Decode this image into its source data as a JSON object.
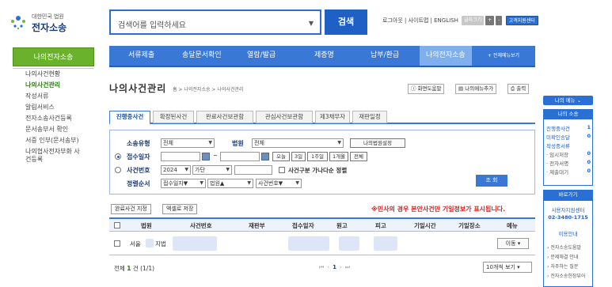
{
  "header": {
    "logo_small": "대한민국 법원",
    "logo_big": "전자소송",
    "search_placeholder": "검색어를 입력하세요",
    "search_button": "검색",
    "toplinks": "로그아웃 | 사이트맵 | ENGLISH",
    "font_label": "글자크기",
    "font_plus": "+",
    "font_minus": "-",
    "support_center": "고객지원센터"
  },
  "left": {
    "title": "나의전자소송",
    "items": [
      {
        "label": "나의사건현황",
        "active": false
      },
      {
        "label": "나의사건관리",
        "active": true
      },
      {
        "label": "작성서류",
        "active": false
      },
      {
        "label": "알림서비스",
        "active": false
      },
      {
        "label": "전자소송사건등록",
        "active": false
      },
      {
        "label": "문서송부서 확인",
        "active": false
      },
      {
        "label": "서증 인부(문서송부)",
        "active": false
      },
      {
        "label": "나의협사전자부화 사건등록",
        "active": false
      }
    ]
  },
  "nav": {
    "items": [
      "서류제출",
      "송달문서확인",
      "열람/발급",
      "제증명",
      "납부/환급",
      "나의전자소송"
    ],
    "more": "+ 전체메뉴보기"
  },
  "page": {
    "title": "나의사건관리",
    "breadcrumb": "홈 > 나의전자소송 > 나의사건관리",
    "help": "화면도움말",
    "add_menu": "나의메뉴추가",
    "print": "출력"
  },
  "tabs": [
    "진행중사건",
    "확정된사건",
    "완료사건보관함",
    "관심사건보관함",
    "제3채무자",
    "재판일정"
  ],
  "filter": {
    "case_type_label": "소송유형",
    "case_type_value": "전체",
    "court_label": "법원",
    "court_value": "전체",
    "my_court_button": "나의법원설정",
    "date_label": "접수일자",
    "date_sep": "~",
    "btn_today": "오늘",
    "btn_3days": "3일",
    "btn_1week": "1주일",
    "btn_1month": "1개월",
    "btn_all": "전체",
    "caseno_label": "사건번호",
    "year_value": "2024",
    "gubun_value": "가단",
    "sort_check_label": "사건구분 가나다순 정렬",
    "order_label": "정렬순서",
    "order1": "접수일자▼",
    "order2": "법원▲",
    "order3": "사건번호▼",
    "lookup": "조 회"
  },
  "results": {
    "btn_complete": "완료사건 지정",
    "btn_excel": "엑셀로 저장",
    "notice": "※민사의 경우 본안사건만 기일정보가 표시됩니다.",
    "columns": [
      "법원",
      "사건번호",
      "재판부",
      "접수일자",
      "원고",
      "피고",
      "기일시간",
      "기일장소",
      "메뉴"
    ],
    "row_court_a": "서울",
    "row_court_b": "지법",
    "move_btn": "이동",
    "total_prefix": "전체",
    "total_count": "1",
    "total_suffix": "건 (1/1)",
    "page_current": "1",
    "per_page": "10개씩 보기"
  },
  "quick": {
    "my_menu": "나의 메뉴",
    "my_litigation": "나의 소송",
    "rows": [
      {
        "label": "진행중사건",
        "num": "1"
      },
      {
        "label": "미확인송달",
        "num": "0"
      },
      {
        "label": "작성중서류",
        "num": ""
      },
      {
        "label": "· 임시저장",
        "num": "0"
      },
      {
        "label": "· 전자서명",
        "num": "0"
      },
      {
        "label": "· 제출대기",
        "num": "0"
      }
    ],
    "shortcut": "바로가기",
    "center_name": "사용자지원센터",
    "center_phone": "02-3480-1715",
    "usage": "이용안내",
    "links": [
      "전자소송도움말",
      "문제해결 안내",
      "자주하는 질문",
      "전자소송헌장뷰어"
    ]
  },
  "colors": {
    "primary_blue": "#3a78d6",
    "green": "#6bb22c",
    "notice_red": "#e02020"
  }
}
